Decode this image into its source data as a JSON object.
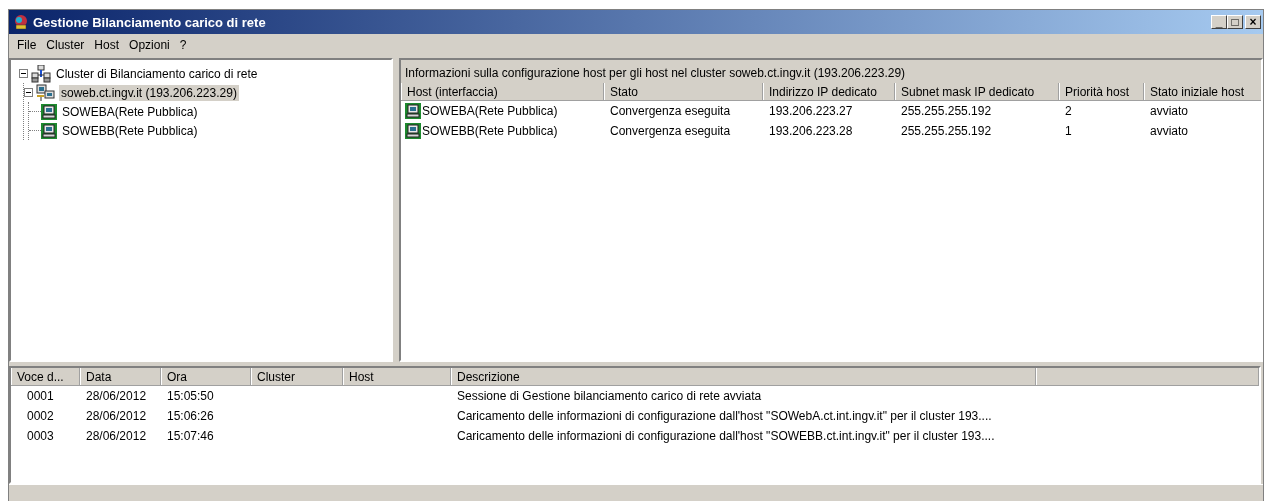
{
  "window": {
    "title": "Gestione Bilanciamento carico di rete",
    "controls": [
      "_",
      "□",
      "×"
    ]
  },
  "menu": [
    {
      "label": "File"
    },
    {
      "label": "Cluster"
    },
    {
      "label": "Host"
    },
    {
      "label": "Opzioni"
    },
    {
      "label": "?"
    }
  ],
  "tree": [
    {
      "kind": "cluster",
      "label": "Cluster di Bilanciamento carico di rete",
      "expanded": true,
      "selected": false,
      "children": [
        {
          "kind": "server",
          "label": "soweb.ct.ingv.it (193.206.223.29)",
          "expanded": true,
          "selected": true,
          "children": [
            {
              "kind": "host",
              "label": "SOWEBA(Rete Pubblica)",
              "selected": false
            },
            {
              "kind": "host",
              "label": "SOWEBB(Rete Pubblica)",
              "selected": false
            }
          ]
        }
      ]
    }
  ],
  "host_panel": {
    "caption": "Informazioni sulla configurazione host per gli host nel cluster soweb.ct.ingv.it (193.206.223.29)",
    "columns": [
      "Host (interfaccia)",
      "Stato",
      "Indirizzo IP dedicato",
      "Subnet mask IP dedicato",
      "Priorità host",
      "Stato iniziale host"
    ],
    "rows": [
      {
        "selected": false,
        "cells": [
          "SOWEBA(Rete Pubblica)",
          "Convergenza eseguita",
          "193.206.223.27",
          "255.255.255.192",
          "2",
          "avviato"
        ]
      },
      {
        "selected": false,
        "cells": [
          "SOWEBB(Rete Pubblica)",
          "Convergenza eseguita",
          "193.206.223.28",
          "255.255.255.192",
          "1",
          "avviato"
        ]
      }
    ]
  },
  "log": {
    "columns": [
      "Voce d...",
      "Data",
      "Ora",
      "Cluster",
      "Host",
      "Descrizione"
    ],
    "rows": [
      {
        "selected": false,
        "cells": [
          "0001",
          "28/06/2012",
          "15:05:50",
          "",
          "",
          "Sessione di Gestione bilanciamento carico di rete avviata"
        ]
      },
      {
        "selected": false,
        "cells": [
          "0002",
          "28/06/2012",
          "15:06:26",
          "",
          "",
          "Caricamento delle informazioni di configurazione dall'host \"SOWebA.ct.int.ingv.it\" per il cluster 193...."
        ]
      },
      {
        "selected": false,
        "cells": [
          "0003",
          "28/06/2012",
          "15:07:46",
          "",
          "",
          "Caricamento delle informazioni di configurazione dall'host \"SOWEBB.ct.int.ingv.it\" per il cluster 193...."
        ]
      }
    ]
  }
}
